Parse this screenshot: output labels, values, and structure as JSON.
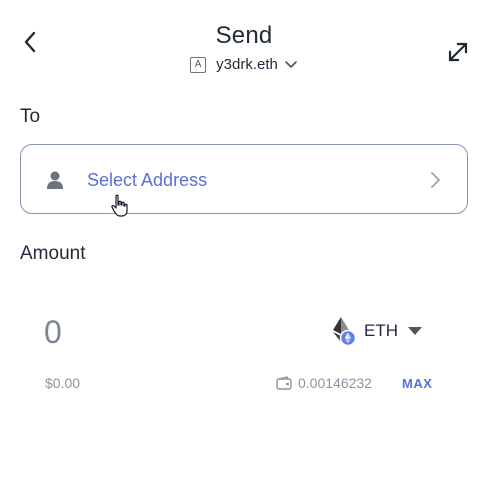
{
  "header": {
    "title": "Send",
    "account_badge": "A",
    "account_name": "y3drk.eth"
  },
  "to": {
    "label": "To",
    "placeholder": "Select Address"
  },
  "amount": {
    "label": "Amount",
    "value": "0",
    "fiat": "$0.00",
    "token": "ETH",
    "balance": "0.00146232",
    "max_label": "MAX"
  },
  "icons": {
    "back": "chevron-left-icon",
    "expand": "expand-icon",
    "dropdown": "chevron-down-icon",
    "person": "person-icon",
    "forward": "chevron-right-icon",
    "token": "eth-icon",
    "wallet": "wallet-icon",
    "cursor": "hand-cursor-icon"
  },
  "colors": {
    "accent": "#5b6fd6",
    "text": "#1f2937",
    "muted": "#8a93a3",
    "border": "#8a95b5"
  }
}
